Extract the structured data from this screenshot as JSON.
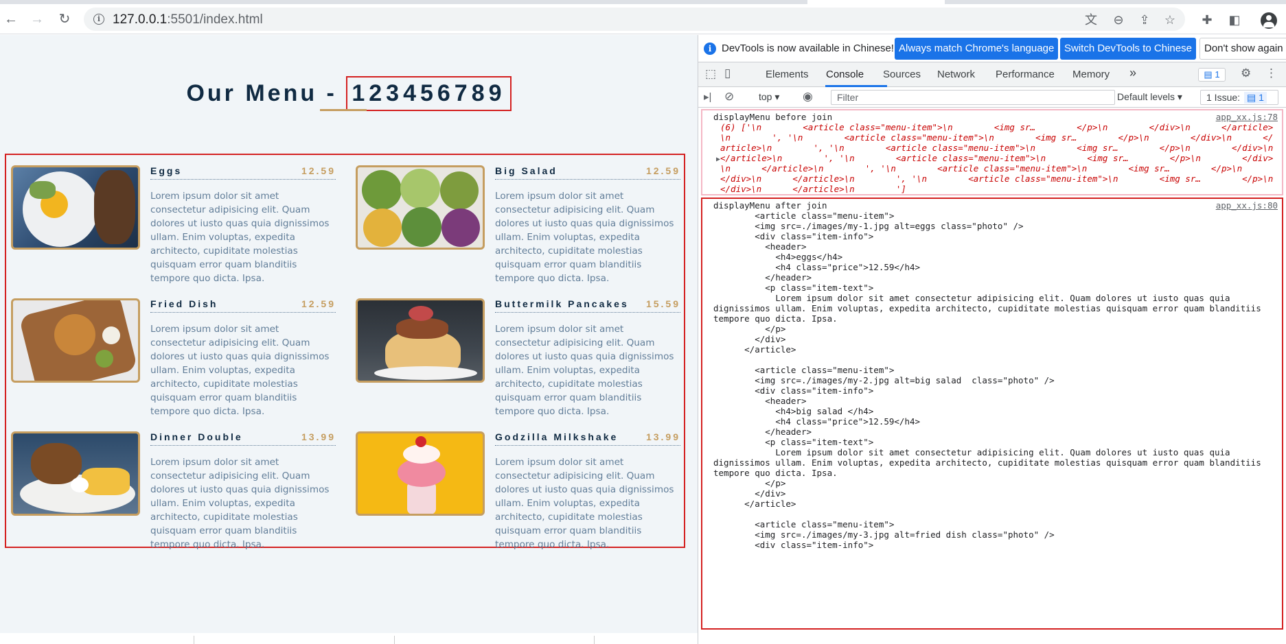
{
  "browser": {
    "url_host": "127.0.0.1",
    "url_path": ":5501/index.html"
  },
  "page": {
    "title_prefix": "Our Menu - ",
    "title_number": "123456789",
    "items": [
      {
        "name": "Eggs",
        "price": "12.59",
        "text": "Lorem ipsum dolor sit amet consectetur adipisicing elit. Quam dolores ut iusto quas quia dignissimos ullam. Enim voluptas, expedita architecto, cupiditate molestias quisquam error quam blanditiis tempore quo dicta. Ipsa."
      },
      {
        "name": "Big Salad",
        "price": "12.59",
        "text": "Lorem ipsum dolor sit amet consectetur adipisicing elit. Quam dolores ut iusto quas quia dignissimos ullam. Enim voluptas, expedita architecto, cupiditate molestias quisquam error quam blanditiis tempore quo dicta. Ipsa."
      },
      {
        "name": "Fried Dish",
        "price": "12.59",
        "text": "Lorem ipsum dolor sit amet consectetur adipisicing elit. Quam dolores ut iusto quas quia dignissimos ullam. Enim voluptas, expedita architecto, cupiditate molestias quisquam error quam blanditiis tempore quo dicta. Ipsa."
      },
      {
        "name": "Buttermilk Pancakes",
        "price": "15.59",
        "text": "Lorem ipsum dolor sit amet consectetur adipisicing elit. Quam dolores ut iusto quas quia dignissimos ullam. Enim voluptas, expedita architecto, cupiditate molestias quisquam error quam blanditiis tempore quo dicta. Ipsa."
      },
      {
        "name": "Dinner Double",
        "price": "13.99",
        "text": "Lorem ipsum dolor sit amet consectetur adipisicing elit. Quam dolores ut iusto quas quia dignissimos ullam. Enim voluptas, expedita architecto, cupiditate molestias quisquam error quam blanditiis tempore quo dicta. Ipsa."
      },
      {
        "name": "Godzilla Milkshake",
        "price": "13.99",
        "text": "Lorem ipsum dolor sit amet consectetur adipisicing elit. Quam dolores ut iusto quas quia dignissimos ullam. Enim voluptas, expedita architecto, cupiditate molestias quisquam error quam blanditiis tempore quo dicta. Ipsa."
      }
    ]
  },
  "devtools": {
    "info_message": "DevTools is now available in Chinese!",
    "btn_match": "Always match Chrome's language",
    "btn_switch": "Switch DevTools to Chinese",
    "btn_dismiss": "Don't show again",
    "tabs": [
      "Elements",
      "Console",
      "Sources",
      "Network",
      "Performance",
      "Memory"
    ],
    "more_tabs": "»",
    "message_count": "1",
    "context": "top",
    "filter_placeholder": "Filter",
    "levels": "Default levels",
    "issues_label": "1 Issue:",
    "issues_count": "1",
    "log1": {
      "label": "displayMenu before join",
      "source": "app_xx.js:78",
      "array": "(6) ['\\n        <article class=\"menu-item\">\\n        <img sr…        </p>\\n        </div>\\n      </article>\\n        ', '\\n        <article class=\"menu-item\">\\n        <img sr…        </p>\\n        </div>\\n      </article>\\n        ', '\\n        <article class=\"menu-item\">\\n        <img sr…        </p>\\n        </div>\\n      </article>\\n        ', '\\n        <article class=\"menu-item\">\\n        <img sr…        </p>\\n        </div>\\n      </article>\\n        ', '\\n        <article class=\"menu-item\">\\n        <img sr…        </p>\\n        </div>\\n      </article>\\n        ', '\\n        <article class=\"menu-item\">\\n        <img sr…        </p>\\n        </div>\\n      </article>\\n        ']"
    },
    "log2": {
      "label": "displayMenu after join",
      "source": "app_xx.js:80",
      "body": "        <article class=\"menu-item\">\n        <img src=./images/my-1.jpg alt=eggs class=\"photo\" />\n        <div class=\"item-info\">\n          <header>\n            <h4>eggs</h4>\n            <h4 class=\"price\">12.59</h4>\n          </header>\n          <p class=\"item-text\">\n            Lorem ipsum dolor sit amet consectetur adipisicing elit. Quam dolores ut iusto quas quia dignissimos ullam. Enim voluptas, expedita architecto, cupiditate molestias quisquam error quam blanditiis tempore quo dicta. Ipsa.\n          </p>\n        </div>\n      </article>\n\n        <article class=\"menu-item\">\n        <img src=./images/my-2.jpg alt=big salad  class=\"photo\" />\n        <div class=\"item-info\">\n          <header>\n            <h4>big salad </h4>\n            <h4 class=\"price\">12.59</h4>\n          </header>\n          <p class=\"item-text\">\n            Lorem ipsum dolor sit amet consectetur adipisicing elit. Quam dolores ut iusto quas quia dignissimos ullam. Enim voluptas, expedita architecto, cupiditate molestias quisquam error quam blanditiis tempore quo dicta. Ipsa.\n          </p>\n        </div>\n      </article>\n\n        <article class=\"menu-item\">\n        <img src=./images/my-3.jpg alt=fried dish class=\"photo\" />\n        <div class=\"item-info\">"
    }
  },
  "colors": {
    "accent_gold": "#c59d5f",
    "heading_navy": "#102a42",
    "highlight_red": "#d42020",
    "devtools_blue": "#1a73e8",
    "error_text": "#c80000"
  }
}
